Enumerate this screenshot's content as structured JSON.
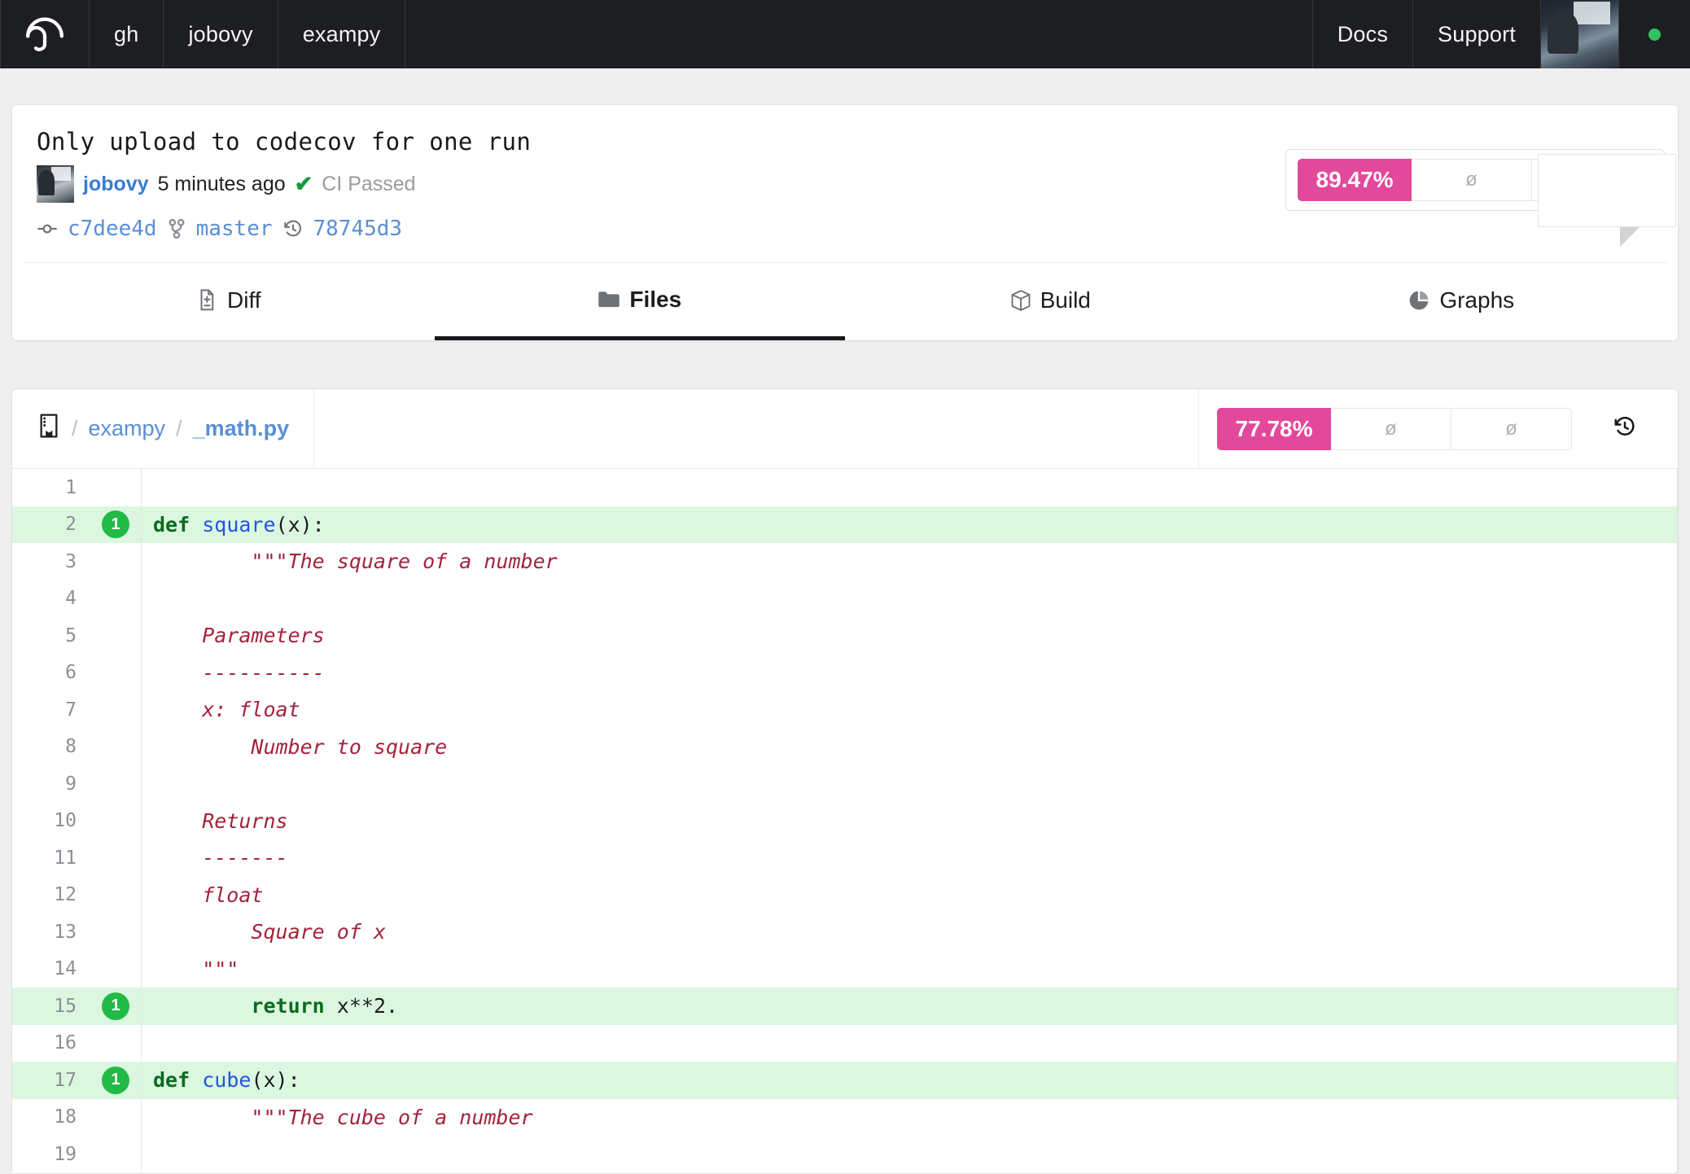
{
  "navbar": {
    "logo_icon": "codecov-umbrella-icon",
    "left_items": [
      {
        "label": "gh",
        "name": "nav-item-gh"
      },
      {
        "label": "jobovy",
        "name": "nav-item-jobovy"
      },
      {
        "label": "exampy",
        "name": "nav-item-exampy"
      }
    ],
    "right_items": [
      {
        "label": "Docs",
        "name": "nav-item-docs"
      },
      {
        "label": "Support",
        "name": "nav-item-support"
      }
    ],
    "avatar_icon": "user-avatar",
    "status_dot_color": "#2fc45f"
  },
  "commit": {
    "title": "Only upload to codecov for one run",
    "author": "jobovy",
    "time_ago": "5 minutes ago",
    "ci_check_icon": "check-icon",
    "ci_status": "CI Passed",
    "commit_icon": "commit-icon",
    "commit_sha": "c7dee4d",
    "branch_icon": "branch-icon",
    "branch": "master",
    "pull_icon": "history-icon",
    "pull_sha": "78745d3",
    "coverage": {
      "percent": "89.47%",
      "cell2": "ø",
      "cell3": "ø",
      "accent_color": "#e3499b"
    }
  },
  "tabs": [
    {
      "label": "Diff",
      "icon": "diff-file-icon",
      "active": false,
      "name": "tab-diff"
    },
    {
      "label": "Files",
      "icon": "folder-icon",
      "active": true,
      "name": "tab-files"
    },
    {
      "label": "Build",
      "icon": "box-icon",
      "active": false,
      "name": "tab-build"
    },
    {
      "label": "Graphs",
      "icon": "pie-chart-icon",
      "active": false,
      "name": "tab-graphs"
    }
  ],
  "file": {
    "book_icon": "book-icon",
    "crumb_root": "/",
    "crumb_dir": "exampy",
    "crumb_sep": "/",
    "crumb_file": "_math.py",
    "history_icon": "history-icon",
    "coverage": {
      "percent": "77.78%",
      "cell2": "ø",
      "cell3": "ø",
      "accent_color": "#e3499b"
    }
  },
  "code_lines": [
    {
      "n": "1",
      "hits": "",
      "covered": false,
      "tokens": []
    },
    {
      "n": "2",
      "hits": "1",
      "covered": true,
      "tokens": [
        {
          "t": "def ",
          "c": "t-kw"
        },
        {
          "t": "square",
          "c": "t-fn"
        },
        {
          "t": "(x):",
          "c": "t-plain"
        }
      ]
    },
    {
      "n": "3",
      "hits": "",
      "covered": false,
      "tokens": [
        {
          "t": "        \"\"\"The square of a number",
          "c": "t-doc"
        }
      ]
    },
    {
      "n": "4",
      "hits": "",
      "covered": false,
      "tokens": []
    },
    {
      "n": "5",
      "hits": "",
      "covered": false,
      "tokens": [
        {
          "t": "    Parameters",
          "c": "t-doc"
        }
      ]
    },
    {
      "n": "6",
      "hits": "",
      "covered": false,
      "tokens": [
        {
          "t": "    ----------",
          "c": "t-doc"
        }
      ]
    },
    {
      "n": "7",
      "hits": "",
      "covered": false,
      "tokens": [
        {
          "t": "    x: float",
          "c": "t-doc"
        }
      ]
    },
    {
      "n": "8",
      "hits": "",
      "covered": false,
      "tokens": [
        {
          "t": "        Number to square",
          "c": "t-doc"
        }
      ]
    },
    {
      "n": "9",
      "hits": "",
      "covered": false,
      "tokens": []
    },
    {
      "n": "10",
      "hits": "",
      "covered": false,
      "tokens": [
        {
          "t": "    Returns",
          "c": "t-doc"
        }
      ]
    },
    {
      "n": "11",
      "hits": "",
      "covered": false,
      "tokens": [
        {
          "t": "    -------",
          "c": "t-doc"
        }
      ]
    },
    {
      "n": "12",
      "hits": "",
      "covered": false,
      "tokens": [
        {
          "t": "    float",
          "c": "t-doc"
        }
      ]
    },
    {
      "n": "13",
      "hits": "",
      "covered": false,
      "tokens": [
        {
          "t": "        Square of x",
          "c": "t-doc"
        }
      ]
    },
    {
      "n": "14",
      "hits": "",
      "covered": false,
      "tokens": [
        {
          "t": "    \"\"\"",
          "c": "t-doc"
        }
      ]
    },
    {
      "n": "15",
      "hits": "1",
      "covered": true,
      "tokens": [
        {
          "t": "        ",
          "c": "t-plain"
        },
        {
          "t": "return",
          "c": "t-kw"
        },
        {
          "t": " x**2.",
          "c": "t-plain"
        }
      ]
    },
    {
      "n": "16",
      "hits": "",
      "covered": false,
      "tokens": []
    },
    {
      "n": "17",
      "hits": "1",
      "covered": true,
      "tokens": [
        {
          "t": "def ",
          "c": "t-kw"
        },
        {
          "t": "cube",
          "c": "t-fn"
        },
        {
          "t": "(x):",
          "c": "t-plain"
        }
      ]
    },
    {
      "n": "18",
      "hits": "",
      "covered": false,
      "tokens": [
        {
          "t": "        \"\"\"The cube of a number",
          "c": "t-doc"
        }
      ]
    },
    {
      "n": "19",
      "hits": "",
      "covered": false,
      "tokens": []
    }
  ]
}
